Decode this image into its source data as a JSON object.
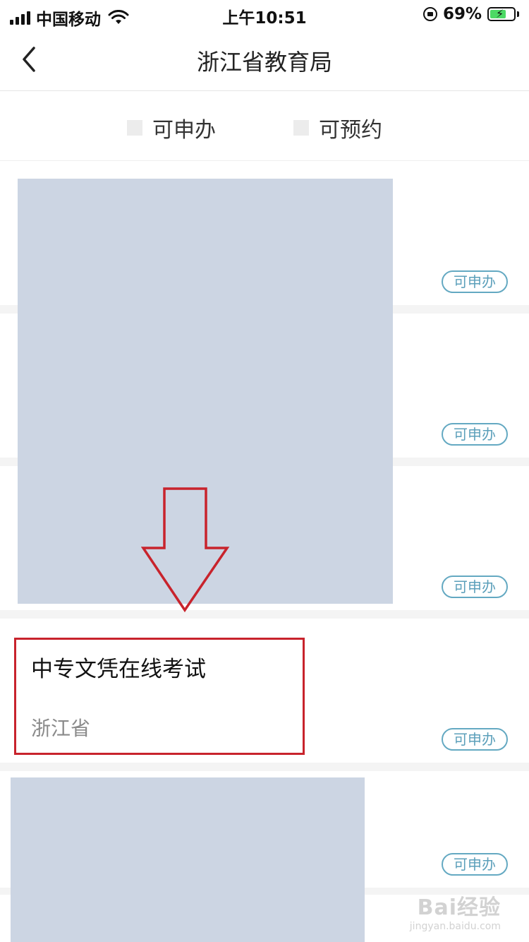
{
  "status_bar": {
    "carrier": "中国移动",
    "time": "上午10:51",
    "battery_percent": "69%",
    "battery_level": 0.69,
    "icons": [
      "signal-icon",
      "wifi-icon",
      "orientation-lock-icon",
      "battery-charging-icon"
    ]
  },
  "nav": {
    "title": "浙江省教育局",
    "back_icon": "chevron-left-icon"
  },
  "filters": [
    {
      "label": "可申办"
    },
    {
      "label": "可预约"
    }
  ],
  "items": [
    {
      "badge": "可申办"
    },
    {
      "badge": "可申办"
    },
    {
      "badge": "可申办"
    },
    {
      "title": "中专文凭在线考试",
      "region": "浙江省",
      "badge": "可申办"
    },
    {
      "badge": "可申办"
    }
  ],
  "annotation": {
    "arrow_color": "#c8232c",
    "highlight_color": "#c8232c"
  },
  "colors": {
    "badge_border": "#64a9c2",
    "redaction": "#ccd5e3"
  },
  "watermark": {
    "main": "Bai经验",
    "sub": "jingyan.baidu.com"
  }
}
